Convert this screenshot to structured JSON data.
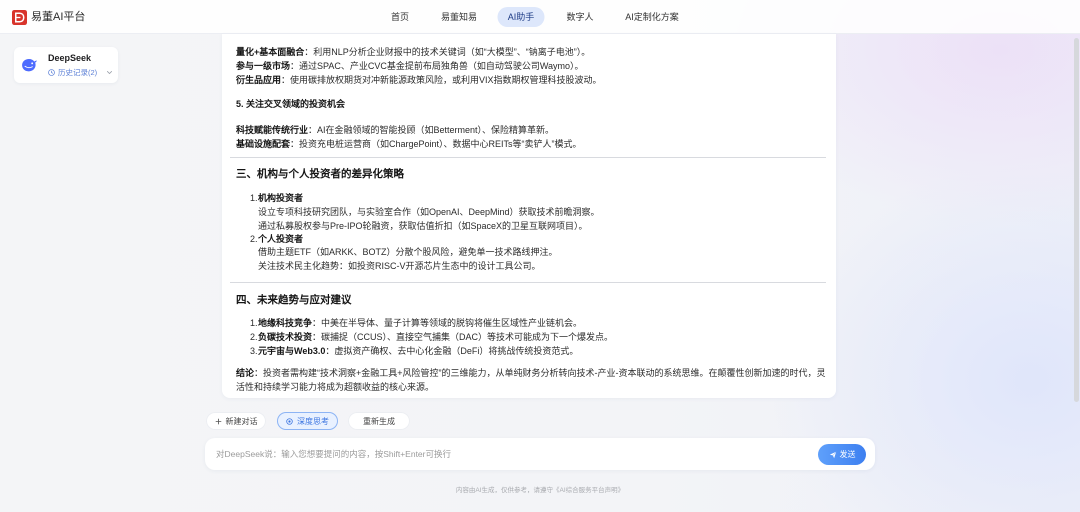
{
  "app": {
    "logo_text": "易董AI平台"
  },
  "nav": {
    "items": [
      {
        "label": "首页"
      },
      {
        "label": "易董知易"
      },
      {
        "label": "AI助手",
        "active": true
      },
      {
        "label": "数字人"
      },
      {
        "label": "AI定制化方案"
      }
    ]
  },
  "sidebar": {
    "model_name": "DeepSeek",
    "history_label": "历史记录(2)"
  },
  "content": {
    "intro": [
      {
        "strong": "量化+基本面融合",
        "text": "：利用NLP分析企业财报中的技术关键词（如“大模型”、“钠离子电池”）。"
      },
      {
        "strong": "参与一级市场",
        "text": "：通过SPAC、产业CVC基金提前布局独角兽（如自动驾驶公司Waymo）。"
      },
      {
        "strong": "衍生品应用",
        "text": "：使用碳排放权期货对冲新能源政策风险，或利用VIX指数期权管理科技股波动。"
      }
    ],
    "cross": {
      "heading": "5. 关注交叉领域的投资机会",
      "items": [
        {
          "strong": "科技赋能传统行业",
          "text": "：AI在金融领域的智能投顾（如Betterment）、保险精算革新。"
        },
        {
          "strong": "基础设施配套",
          "text": "：投资充电桩运营商（如ChargePoint）、数据中心REITs等“卖铲人”模式。"
        }
      ]
    },
    "strategy": {
      "heading": "三、机构与个人投资者的差异化策略",
      "groups": [
        {
          "num": "1.",
          "title": "机构投资者",
          "points": [
            "设立专项科技研究团队，与实验室合作（如OpenAI、DeepMind）获取技术前瞻洞察。",
            "通过私募股权参与Pre-IPO轮融资，获取估值折扣（如SpaceX的卫星互联网项目）。"
          ]
        },
        {
          "num": "2.",
          "title": "个人投资者",
          "points": [
            "借助主题ETF（如ARKK、BOTZ）分散个股风险，避免单一技术路线押注。",
            "关注技术民主化趋势：如投资RISC-V开源芯片生态中的设计工具公司。"
          ]
        }
      ]
    },
    "trends": {
      "heading": "四、未来趋势与应对建议",
      "items": [
        {
          "num": "1.",
          "strong": "地缘科技竞争",
          "text": "：中美在半导体、量子计算等领域的脱钩将催生区域性产业链机会。"
        },
        {
          "num": "2.",
          "strong": "负碳技术投资",
          "text": "：碳捕捉（CCUS）、直接空气捕集（DAC）等技术可能成为下一个爆发点。"
        },
        {
          "num": "3.",
          "strong": "元宇宙与Web3.0",
          "text": "：虚拟资产确权、去中心化金融（DeFi）将挑战传统投资范式。"
        }
      ]
    },
    "conclusion": {
      "strong": "结论",
      "text": "：投资者需构建“技术洞察+金融工具+风险管控”的三维能力，从单纯财务分析转向技术-产业-资本联动的系统思维。在颠覆性创新加速的时代，灵活性和持续学习能力将成为超额收益的核心来源。"
    }
  },
  "actions": {
    "new_chat": "新建对话",
    "deep_think": "深度思考",
    "regenerate": "重新生成"
  },
  "composer": {
    "placeholder": "对DeepSeek说：输入您想要提问的内容，按Shift+Enter可换行",
    "value": "",
    "send_label": "发送"
  },
  "footer": {
    "disclaimer": "内容由AI生成，仅供参考，请遵守《AI综合服务平台声明》"
  },
  "icons": {
    "brand": "logo-icon",
    "model": "deepseek-whale-icon",
    "history": "clock-icon",
    "expand": "chevron-down-icon",
    "new_chat": "plus-icon",
    "deep_think": "deep-think-icon",
    "send": "send-icon"
  },
  "colors": {
    "brand_red": "#d8342b",
    "accent_blue": "#3d7ff0",
    "deepseek_blue": "#4d6bfe",
    "active_nav_bg": "#dde7fb",
    "text": "#222222"
  }
}
